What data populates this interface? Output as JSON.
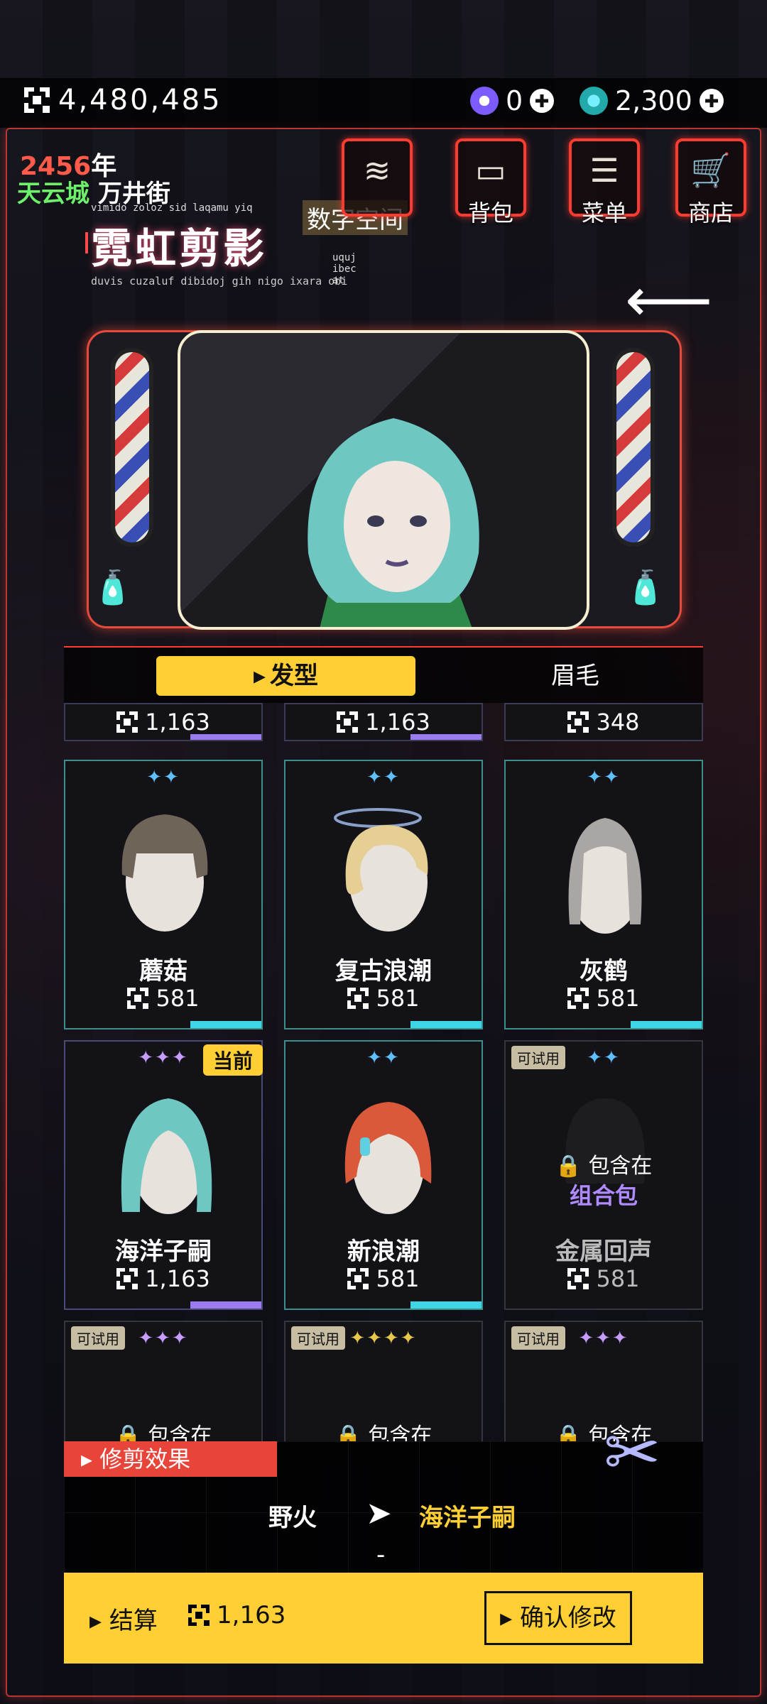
{
  "topbar": {
    "money": "4,480,485",
    "currency_a": "0",
    "currency_b": "2,300"
  },
  "header": {
    "year_num": "2456",
    "year_unit": "年",
    "city_a": "天云城",
    "city_b": "万井街",
    "shop_small_top": "vimido zoloz sid laqamu yiq",
    "shop_title": "霓虹剪影",
    "shop_small_side": "uquj ibec at",
    "shop_small_bottom": "duvis cuzaluf dibidoj gih nigo ixara obi"
  },
  "nav": {
    "digital_space": "数字空间",
    "bag": "背包",
    "menu": "菜单",
    "shop": "商店"
  },
  "tabs": {
    "hair": "发型",
    "brows": "眉毛"
  },
  "partial_prices": [
    "1,163",
    "1,163",
    "348"
  ],
  "cards": [
    {
      "name": "蘑菇",
      "price": "581",
      "stars": "✦✦"
    },
    {
      "name": "复古浪潮",
      "price": "581",
      "stars": "✦✦"
    },
    {
      "name": "灰鹤",
      "price": "581",
      "stars": "✦✦"
    },
    {
      "name": "海洋子嗣",
      "price": "1,163",
      "stars": "✦✦✦",
      "badge": "当前"
    },
    {
      "name": "新浪潮",
      "price": "581",
      "stars": "✦✦"
    },
    {
      "name": "金属回声",
      "price": "581",
      "stars": "✦✦",
      "trial": "可试用",
      "lock": "包含在",
      "bundle": "组合包"
    }
  ],
  "bottom_row": [
    {
      "trial": "可试用",
      "stars": "✦✦✦",
      "lock": "包含在"
    },
    {
      "trial": "可试用",
      "stars": "✦✦✦✦",
      "lock": "包含在"
    },
    {
      "trial": "可试用",
      "stars": "✦✦✦",
      "lock": "包含在"
    }
  ],
  "trim": {
    "header": "修剪效果",
    "from": "野火",
    "to": "海洋子嗣",
    "dash": "-"
  },
  "checkout": {
    "label": "结算",
    "price": "1,163",
    "confirm": "确认修改"
  },
  "colors": {
    "accent": "#ffcf33",
    "neon_red": "#ff3b30",
    "teal_border": "#3b8f8c",
    "purple": "#9b7cf0"
  }
}
